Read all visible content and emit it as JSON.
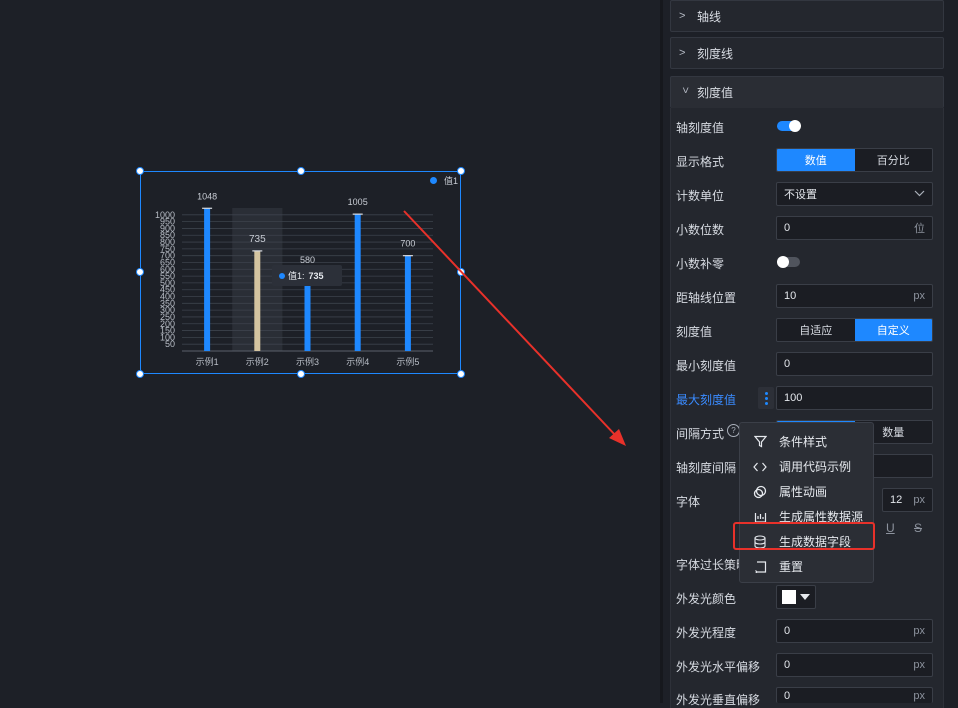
{
  "chart_data": {
    "type": "bar",
    "categories": [
      "示例1",
      "示例2",
      "示例3",
      "示例4",
      "示例5"
    ],
    "series": [
      {
        "name": "值1",
        "values": [
          1048,
          735,
          580,
          1005,
          700
        ]
      }
    ],
    "y_ticks": [
      50,
      100,
      150,
      200,
      250,
      300,
      350,
      400,
      450,
      500,
      550,
      600,
      650,
      700,
      750,
      800,
      850,
      900,
      950,
      1000
    ],
    "ylim": [
      0,
      1050
    ],
    "highlight_index": 1,
    "bar_color": "#1e88ff",
    "highlight_color": "#d4c4a0",
    "tooltip": {
      "label": "值1:",
      "value": "735"
    },
    "grid": true,
    "legend": "top-right"
  },
  "panel": {
    "sections": {
      "axis_line": "轴线",
      "tick_line": "刻度线",
      "tick_value": "刻度值"
    },
    "rows": {
      "axis_tick_value": "轴刻度值",
      "display_format": "显示格式",
      "format_numeric": "数值",
      "format_percent": "百分比",
      "count_unit": "计数单位",
      "count_unit_value": "不设置",
      "decimal_places": "小数位数",
      "decimal_value": "0",
      "decimal_unit": "位",
      "decimal_pad": "小数补零",
      "distance": "距轴线位置",
      "distance_value": "10",
      "px": "px",
      "tick_mode": "刻度值",
      "mode_auto": "自适应",
      "mode_custom": "自定义",
      "min_tick": "最小刻度值",
      "min_value": "0",
      "max_tick": "最大刻度值",
      "max_value": "100",
      "interval_mode": "间隔方式",
      "interval_count": "数量",
      "axis_interval": "轴刻度间隔",
      "font": "字体",
      "font_size": "12",
      "overflow": "字体过长策略",
      "glow_color": "外发光颜色",
      "glow_degree": "外发光程度",
      "glow_degree_value": "0",
      "glow_h_offset": "外发光水平偏移",
      "glow_h_value": "0",
      "glow_v_offset": "外发光垂直偏移",
      "glow_v_value": "0"
    }
  },
  "menu": {
    "items": [
      {
        "label": "条件样式",
        "icon": "filter-icon"
      },
      {
        "label": "调用代码示例",
        "icon": "code-icon"
      },
      {
        "label": "属性动画",
        "icon": "animation-icon"
      },
      {
        "label": "生成属性数据源",
        "icon": "datasource-icon"
      },
      {
        "label": "生成数据字段",
        "icon": "database-icon"
      },
      {
        "label": "重置",
        "icon": "reset-icon"
      }
    ]
  },
  "colors": {
    "accent": "#1e88ff",
    "annotation": "#e8312a"
  }
}
